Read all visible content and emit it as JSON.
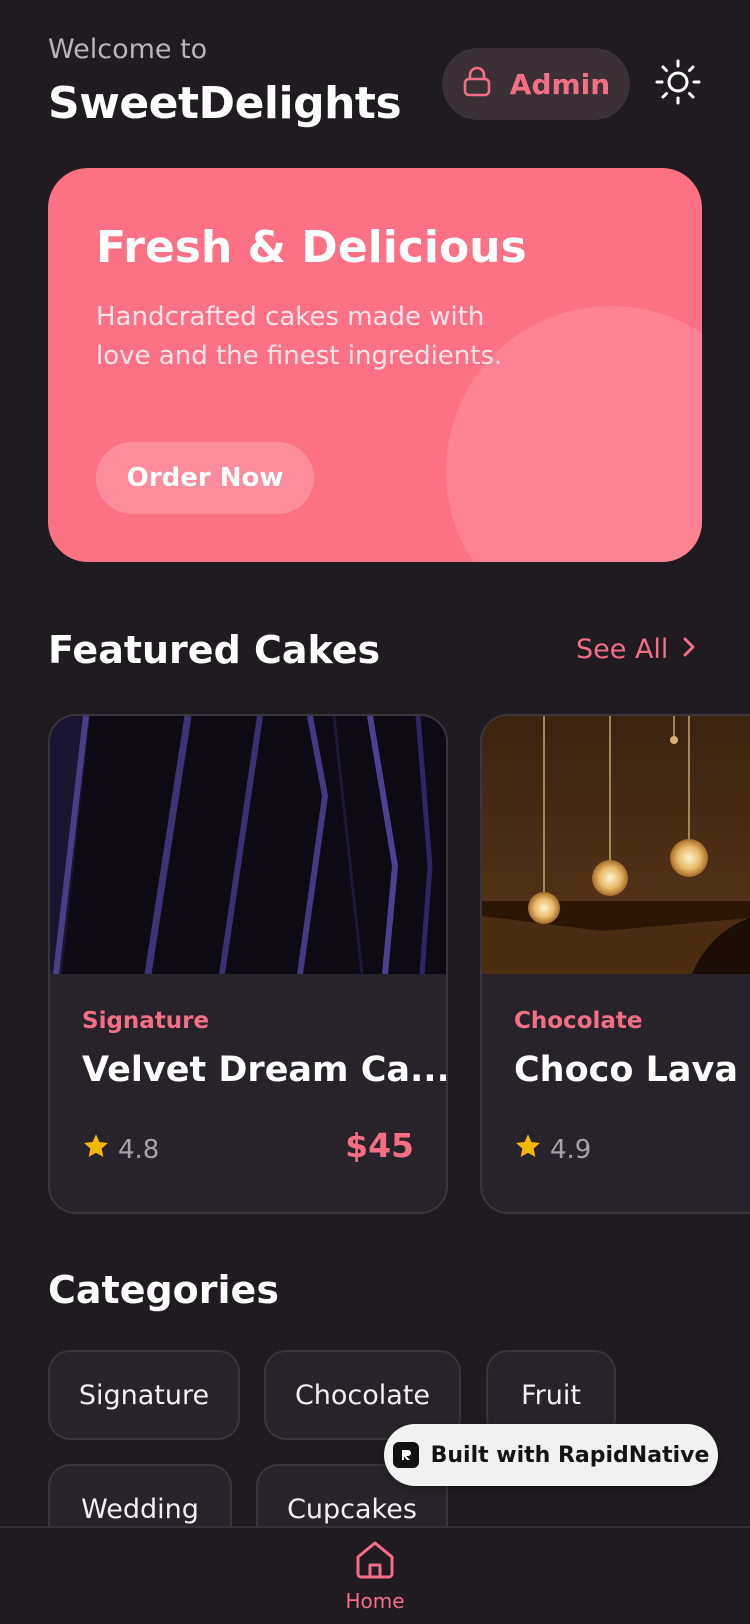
{
  "header": {
    "welcome": "Welcome to",
    "brand": "SweetDelights",
    "admin_label": "Admin"
  },
  "hero": {
    "title": "Fresh & Delicious",
    "subtitle": "Handcrafted cakes made with love and the finest ingredients.",
    "cta": "Order Now"
  },
  "featured": {
    "title": "Featured Cakes",
    "see_all": "See All",
    "cards": [
      {
        "category": "Signature",
        "name": "Velvet Dream Ca...",
        "rating": "4.8",
        "price": "$45"
      },
      {
        "category": "Chocolate",
        "name": "Choco Lava D",
        "rating": "4.9",
        "price": ""
      }
    ]
  },
  "categories": {
    "title": "Categories",
    "items": [
      "Signature",
      "Chocolate",
      "Fruit",
      "Wedding",
      "Cupcakes"
    ]
  },
  "badge": {
    "label": "Built with RapidNative"
  },
  "nav": {
    "home": "Home"
  },
  "colors": {
    "accent": "#f36f86",
    "hero_bg": "#fd7185",
    "bg": "#1f1b20",
    "card_bg": "#28232a"
  }
}
